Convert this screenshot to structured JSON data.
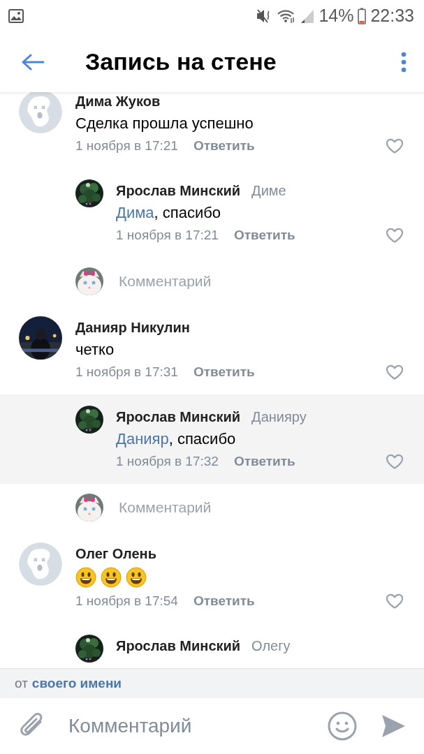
{
  "status_bar": {
    "battery": "14%",
    "time": "22:33"
  },
  "header": {
    "title": "Запись на стене"
  },
  "feed": [
    {
      "kind": "comment",
      "avatar": {
        "kind": "default"
      },
      "author": "Дима Жуков",
      "text": "Сделка прошла успешно",
      "date": "1 ноября в 17:21",
      "reply_label": "Ответить"
    },
    {
      "kind": "reply",
      "author": "Ярослав Минский",
      "addressee": "Диме",
      "mention": "Дима",
      "text": ", спасибо",
      "date": "1 ноября в 17:21",
      "reply_label": "Ответить"
    },
    {
      "kind": "prompt",
      "label": "Комментарий"
    },
    {
      "kind": "comment",
      "author": "Данияр Никулин",
      "text": "четко",
      "date": "1 ноября в 17:31",
      "reply_label": "Ответить"
    },
    {
      "kind": "highlighted_reply",
      "author": "Ярослав Минский",
      "addressee": "Данияру",
      "mention": "Данияр",
      "text": ", спасибо",
      "date": "1 ноября в 17:32",
      "reply_label": "Ответить"
    },
    {
      "kind": "prompt",
      "label": "Комментарий"
    },
    {
      "kind": "comment",
      "avatar": {
        "kind": "default"
      },
      "author": "Олег Олень",
      "emojis": [
        {
          "kind": "smiley"
        },
        {
          "kind": "smiley"
        },
        {
          "kind": "smiley"
        }
      ],
      "date": "1 ноября в 17:54",
      "reply_label": "Ответить"
    },
    {
      "kind": "reply",
      "author": "Ярослав Минский",
      "addressee": "Олегу"
    }
  ],
  "sender_bar": {
    "prefix": "от",
    "name": "своего имени"
  },
  "composer": {
    "placeholder": "Комментарий"
  }
}
